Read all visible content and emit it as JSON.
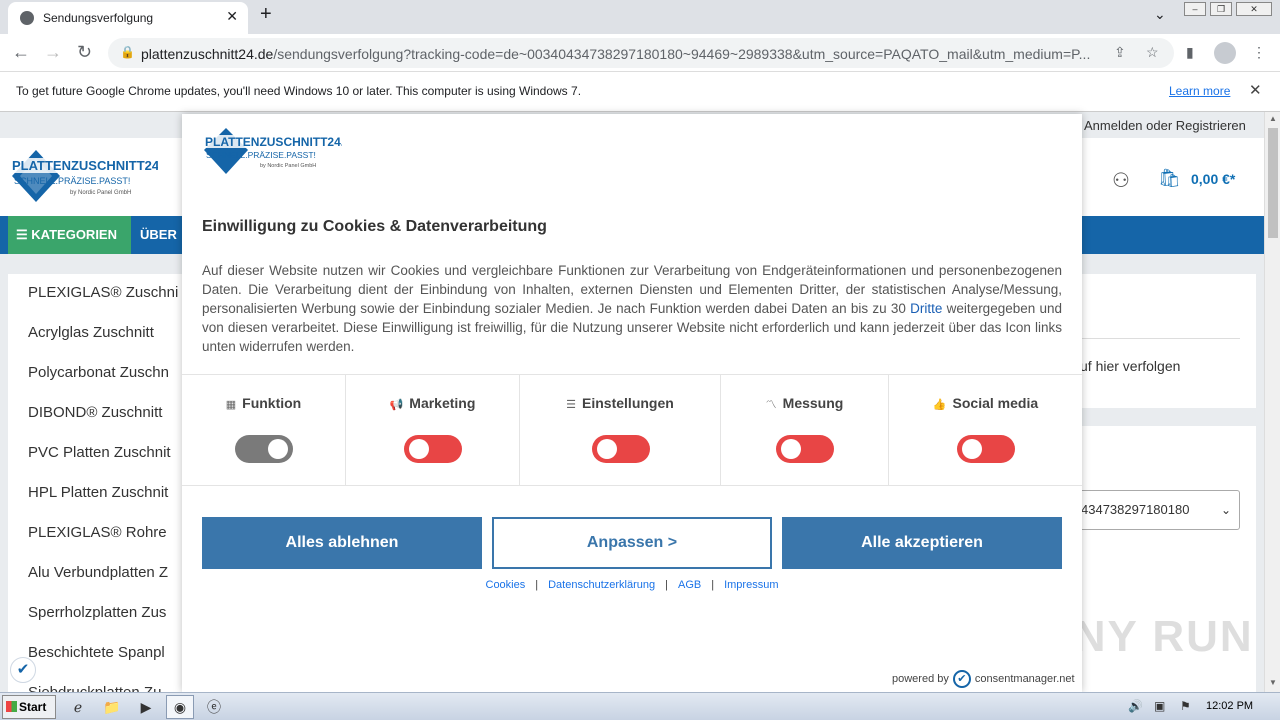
{
  "browser": {
    "tab_title": "Sendungsverfolgung",
    "new_tab": "+",
    "tab_close": "✕",
    "url_host": "plattenzuschnitt24.de",
    "url_path": "/sendungsverfolgung?tracking-code=de~00340434738297180180~94469~2989338&utm_source=PAQATO_mail&utm_medium=P...",
    "infobar_message": "To get future Google Chrome updates, you'll need Windows 10 or later. This computer is using Windows 7.",
    "infobar_link": "Learn more",
    "infobar_close": "✕"
  },
  "site": {
    "login_text": "Anmelden oder Registrieren",
    "cart_price": "0,00 €*",
    "nav": {
      "categories": "KATEGORIEN",
      "about": "ÜBER"
    },
    "sidebar_items": [
      "PLEXIGLAS® Zuschni",
      "Acrylglas Zuschnitt",
      "Polycarbonat Zuschn",
      "DIBOND® Zuschnitt",
      "PVC Platten Zuschnit",
      "HPL Platten Zuschnit",
      "PLEXIGLAS® Rohre",
      "Alu Verbundplatten Z",
      "Sperrholzplatten Zus",
      "Beschichtete Spanpl",
      "Siebdruckplatten Zu"
    ],
    "right_text": "uf hier verfolgen",
    "tracking_select": "434738297180180",
    "watermark": "ANY RUN"
  },
  "consent": {
    "title": "Einwilligung zu Cookies & Datenverarbeitung",
    "text_before": "Auf dieser Website nutzen wir Cookies und vergleichbare Funktionen zur Verarbeitung von Endgeräteinformationen und personenbezogenen Daten. Die Verarbeitung dient der Einbindung von Inhalten, externen Diensten und Elementen Dritter, der statistischen Analyse/Messung, personalisierten Werbung sowie der Einbindung sozialer Medien. Je nach Funktion werden dabei Daten an bis zu 30 ",
    "text_link": "Dritte",
    "text_after": " weitergegeben und von diesen verarbeitet. Diese Einwilligung ist freiwillig, für die Nutzung unserer Website nicht erforderlich und kann jederzeit über das Icon links unten widerrufen werden.",
    "categories": [
      {
        "label": "Funktion",
        "icon": "grid-icon",
        "enabled": true
      },
      {
        "label": "Marketing",
        "icon": "megaphone-icon",
        "enabled": false
      },
      {
        "label": "Einstellungen",
        "icon": "sliders-icon",
        "enabled": false
      },
      {
        "label": "Messung",
        "icon": "chart-icon",
        "enabled": false
      },
      {
        "label": "Social media",
        "icon": "thumbs-up-icon",
        "enabled": false
      }
    ],
    "buttons": {
      "reject": "Alles ablehnen",
      "customize": "Anpassen >",
      "accept": "Alle akzeptieren"
    },
    "links": [
      "Cookies",
      "Datenschutzerklärung",
      "AGB",
      "Impressum"
    ],
    "powered_prefix": "powered by",
    "powered_name": "consentmanager.net"
  },
  "logo": {
    "name": "PLATTENZUSCHNITT24.DE",
    "tagline": "SCHNELL.PRÄZISE.PASST!",
    "sub": "by Nordic Panel GmbH"
  },
  "taskbar": {
    "start": "Start",
    "clock": "12:02 PM"
  },
  "colors": {
    "primary": "#1565a8",
    "green": "#3aa56b",
    "toggle_off": "#e84545",
    "toggle_on": "#7a7a7a",
    "button": "#3a76ab"
  }
}
